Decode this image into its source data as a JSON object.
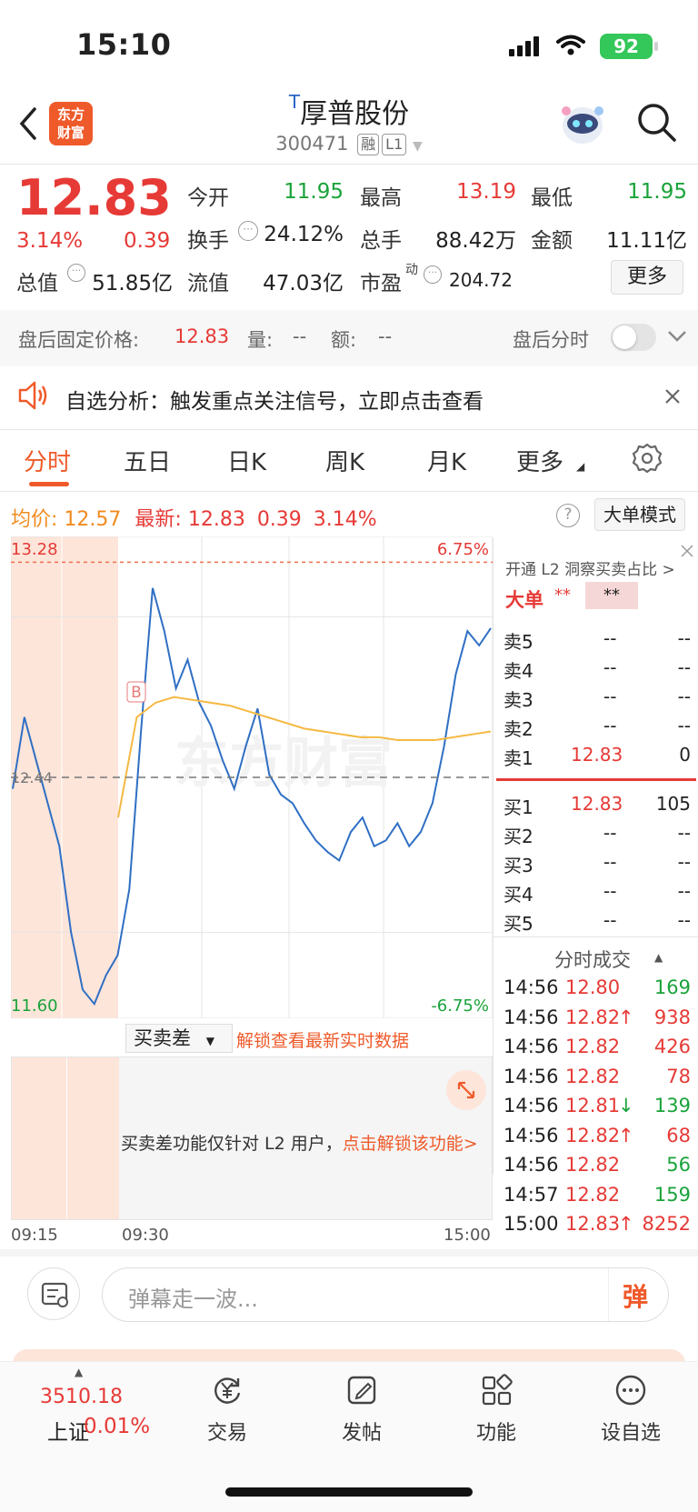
{
  "status": {
    "time": "15:10",
    "battery": "92"
  },
  "header": {
    "logo_line1": "东方",
    "logo_line2": "财富",
    "tag_t": "T",
    "stock_name": "厚普股份",
    "code": "300471",
    "tag_rong": "融",
    "tag_level": "L1"
  },
  "quote": {
    "price": "12.83",
    "change_pct": "3.14%",
    "change": "0.39",
    "open_label": "今开",
    "open": "11.95",
    "high_label": "最高",
    "high": "13.19",
    "low_label": "最低",
    "low": "11.95",
    "turnover_label": "换手",
    "turnover": "24.12%",
    "volume_label": "总手",
    "volume": "88.42万",
    "amount_label": "金额",
    "amount": "11.11亿",
    "mktcap_label": "总值",
    "mktcap": "51.85亿",
    "float_label": "流值",
    "float": "47.03亿",
    "pe_label": "市盈",
    "pe_sup": "动",
    "pe": "204.72",
    "more": "更多"
  },
  "afterhours": {
    "label": "盘后固定价格:",
    "price": "12.83",
    "vol_label": "量:",
    "vol": "--",
    "amt_label": "额:",
    "amt": "--",
    "intraday_label": "盘后分时"
  },
  "banner": {
    "text": "自选分析：触发重点关注信号，立即点击查看"
  },
  "tabs": [
    "分时",
    "五日",
    "日K",
    "周K",
    "月K",
    "更多"
  ],
  "info": {
    "avg_label": "均价:",
    "avg": "12.57",
    "last_label": "最新:",
    "last": "12.83",
    "chg": "0.39",
    "pct": "3.14%",
    "mode_btn": "大单模式"
  },
  "chart_data": {
    "type": "line",
    "title": "",
    "ylim": [
      11.6,
      13.28
    ],
    "y_top_label": "13.28",
    "y_bottom_label": "11.60",
    "pct_top": "6.75%",
    "pct_bottom": "-6.75%",
    "prev_close_label": "12.44",
    "time_labels": [
      "09:15",
      "09:30",
      "15:00"
    ],
    "marker": "B",
    "series": [
      {
        "values": [
          12.4,
          12.65,
          12.5,
          12.35,
          12.2,
          11.9,
          11.7,
          11.65,
          11.75,
          11.82,
          12.05,
          12.6,
          13.1,
          12.95,
          12.75,
          12.85,
          12.7,
          12.62,
          12.5,
          12.4,
          12.55,
          12.68,
          12.45,
          12.38,
          12.35,
          12.28,
          12.22,
          12.18,
          12.15,
          12.25,
          12.3,
          12.2,
          12.22,
          12.28,
          12.2,
          12.25,
          12.35,
          12.55,
          12.8,
          12.95,
          12.9,
          12.96
        ]
      },
      {
        "values": [
          12.3,
          12.65,
          12.7,
          12.72,
          12.71,
          12.7,
          12.69,
          12.67,
          12.65,
          12.63,
          12.61,
          12.6,
          12.59,
          12.58,
          12.58,
          12.57,
          12.57,
          12.57,
          12.58,
          12.59,
          12.6
        ]
      }
    ]
  },
  "order_book": {
    "l2_text": "开通 L2 洞察买卖占比 >",
    "big_label": "大单",
    "masked": "**",
    "sell": [
      {
        "label": "卖5",
        "price": "--",
        "vol": "--"
      },
      {
        "label": "卖4",
        "price": "--",
        "vol": "--"
      },
      {
        "label": "卖3",
        "price": "--",
        "vol": "--"
      },
      {
        "label": "卖2",
        "price": "--",
        "vol": "--"
      },
      {
        "label": "卖1",
        "price": "12.83",
        "vol": "0"
      }
    ],
    "buy": [
      {
        "label": "买1",
        "price": "12.83",
        "vol": "105"
      },
      {
        "label": "买2",
        "price": "--",
        "vol": "--"
      },
      {
        "label": "买3",
        "price": "--",
        "vol": "--"
      },
      {
        "label": "买4",
        "price": "--",
        "vol": "--"
      },
      {
        "label": "买5",
        "price": "--",
        "vol": "--"
      }
    ]
  },
  "trades": {
    "title": "分时成交",
    "rows": [
      {
        "time": "14:56",
        "price": "12.80",
        "arrow": "",
        "vol": "169",
        "color": "green"
      },
      {
        "time": "14:56",
        "price": "12.82",
        "arrow": "↑",
        "vol": "938",
        "color": "red"
      },
      {
        "time": "14:56",
        "price": "12.82",
        "arrow": "",
        "vol": "426",
        "color": "red"
      },
      {
        "time": "14:56",
        "price": "12.82",
        "arrow": "",
        "vol": "78",
        "color": "red"
      },
      {
        "time": "14:56",
        "price": "12.81",
        "arrow": "↓",
        "vol": "139",
        "color": "green"
      },
      {
        "time": "14:56",
        "price": "12.82",
        "arrow": "↑",
        "vol": "68",
        "color": "red"
      },
      {
        "time": "14:56",
        "price": "12.82",
        "arrow": "",
        "vol": "56",
        "color": "green"
      },
      {
        "time": "14:57",
        "price": "12.82",
        "arrow": "",
        "vol": "159",
        "color": "green"
      },
      {
        "time": "15:00",
        "price": "12.83",
        "arrow": "↑",
        "vol": "8252",
        "color": "red"
      }
    ]
  },
  "subchart": {
    "selector": "买卖差",
    "unlock_link": "解锁查看最新实时数据",
    "notice": "买卖差功能仅针对 L2 用户，",
    "notice_link": "点击解锁该功能>"
  },
  "comment": {
    "placeholder": "弹幕走一波...",
    "send": "弹"
  },
  "nav": {
    "index_value": "3510.18",
    "index_name": "上证",
    "index_pct": "0.01%",
    "items": [
      "交易",
      "发帖",
      "功能",
      "设自选"
    ]
  }
}
